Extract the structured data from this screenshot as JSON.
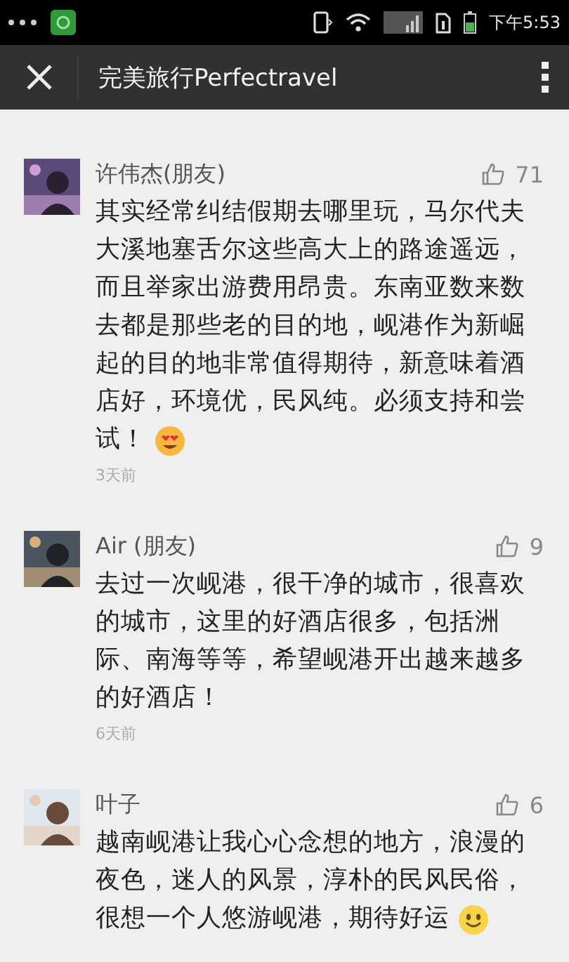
{
  "status_bar": {
    "time": "下午5:53"
  },
  "app_bar": {
    "title": "完美旅行Perfectravel"
  },
  "comments": [
    {
      "name": "许伟杰(朋友)",
      "likes": "71",
      "lines": [
        "其实经常纠结假期去哪里玩，马尔代夫",
        "大溪地塞舌尔这些高大上的路途遥远，",
        "而且举家出游费用昂贵。东南亚数来数",
        "去都是那些老的目的地，岘港作为新崛",
        "起的目的地非常值得期待，新意味着酒",
        "店好，环境优，民风纯。必须支持和尝",
        "试！"
      ],
      "emoji": {
        "kind": "heart-eyes"
      },
      "time": "3天前"
    },
    {
      "name": "Air (朋友)",
      "likes": "9",
      "lines": [
        "去过一次岘港，很干净的城市，很喜欢",
        "的城市，这里的好酒店很多，包括洲",
        "际、南海等等，希望岘港开出越来越多",
        "的好酒店！"
      ],
      "time": "6天前"
    },
    {
      "name": "叶子",
      "likes": "6",
      "lines": [
        "越南岘港让我心心念想的地方，浪漫的",
        "夜色，迷人的风景，淳朴的民风民俗，",
        "很想一个人悠游岘港，期待好运"
      ],
      "emoji": {
        "kind": "smile"
      }
    }
  ]
}
